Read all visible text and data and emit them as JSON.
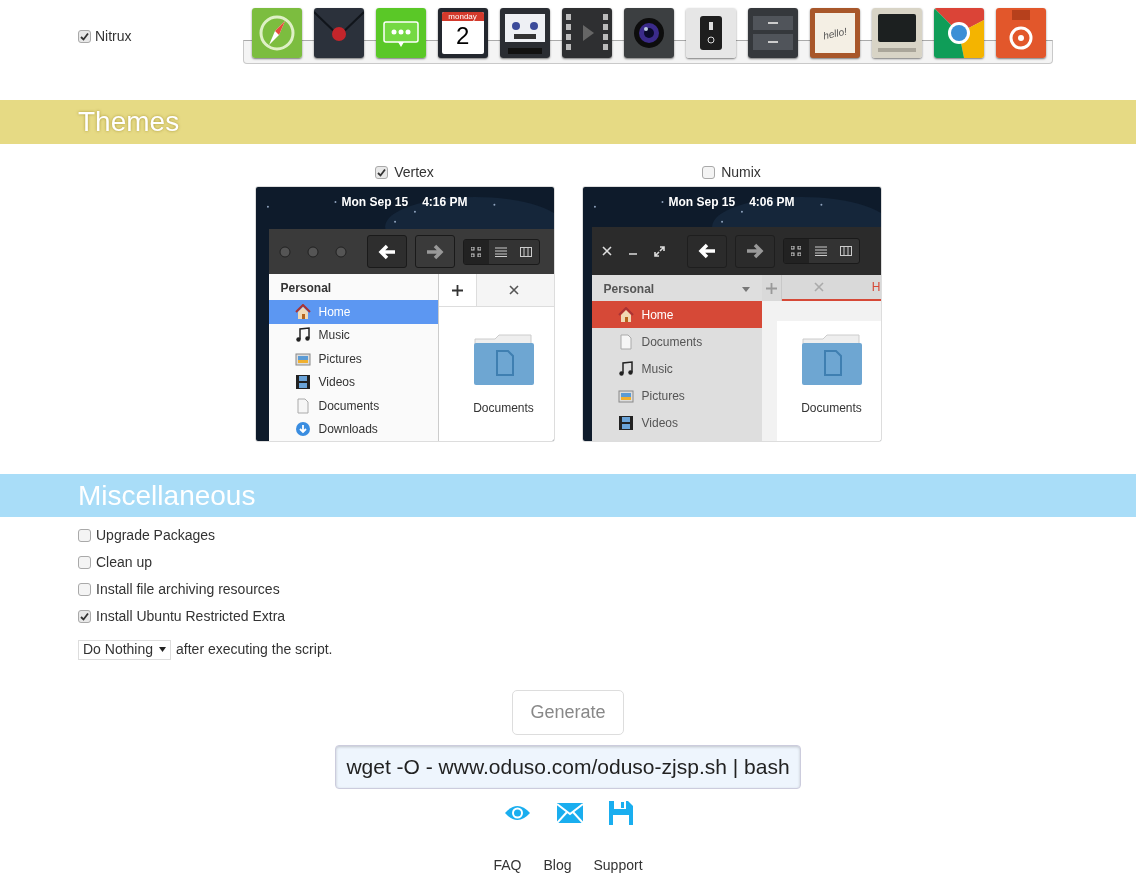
{
  "dock": {
    "label": "Nitrux",
    "checked": true,
    "icons": [
      {
        "kind": "compass"
      },
      {
        "kind": "mail"
      },
      {
        "kind": "messages"
      },
      {
        "kind": "calendar",
        "weekday": "monday",
        "day": "2"
      },
      {
        "kind": "tape"
      },
      {
        "kind": "video"
      },
      {
        "kind": "camera"
      },
      {
        "kind": "switch"
      },
      {
        "kind": "cabinet"
      },
      {
        "kind": "notepad",
        "text": "hello!"
      },
      {
        "kind": "terminal"
      },
      {
        "kind": "browser"
      },
      {
        "kind": "store"
      }
    ]
  },
  "themes": {
    "title": "Themes",
    "options": [
      {
        "label": "Vertex",
        "checked": true,
        "preview": {
          "kind": "vertex",
          "date": "Mon Sep 15",
          "time": "4:16 PM",
          "section": "Personal",
          "tabs": [
            {
              "selected": true
            }
          ],
          "folder": "Documents",
          "items": [
            {
              "kind": "home",
              "label": "Home",
              "selected": true
            },
            {
              "kind": "music",
              "label": "Music",
              "selected": false
            },
            {
              "kind": "pictures",
              "label": "Pictures",
              "selected": false
            },
            {
              "kind": "videos",
              "label": "Videos",
              "selected": false
            },
            {
              "kind": "documents",
              "label": "Documents",
              "selected": false
            },
            {
              "kind": "downloads",
              "label": "Downloads",
              "selected": false
            }
          ]
        }
      },
      {
        "label": "Numix",
        "checked": false,
        "preview": {
          "kind": "numix",
          "date": "Mon Sep 15",
          "time": "4:06 PM",
          "section": "Personal",
          "tabs": [
            {
              "label": "H",
              "selected": true
            }
          ],
          "folder": "Documents",
          "items": [
            {
              "kind": "home",
              "label": "Home",
              "selected": true
            },
            {
              "kind": "documents",
              "label": "Documents",
              "selected": false
            },
            {
              "kind": "music",
              "label": "Music",
              "selected": false
            },
            {
              "kind": "pictures",
              "label": "Pictures",
              "selected": false
            },
            {
              "kind": "videos",
              "label": "Videos",
              "selected": false
            }
          ]
        }
      }
    ]
  },
  "misc": {
    "title": "Miscellaneous",
    "options": [
      {
        "label": "Upgrade Packages",
        "checked": false
      },
      {
        "label": "Clean up",
        "checked": false
      },
      {
        "label": "Install file archiving resources",
        "checked": false
      },
      {
        "label": "Install Ubuntu Restricted Extra",
        "checked": true
      }
    ],
    "after_select": {
      "value": "Do Nothing"
    },
    "after_text": "after executing the script."
  },
  "generate_button": "Generate",
  "command": "wget -O - www.oduso.com/oduso-zjsp.sh | bash",
  "footer_links": [
    "FAQ",
    "Blog",
    "Support"
  ]
}
